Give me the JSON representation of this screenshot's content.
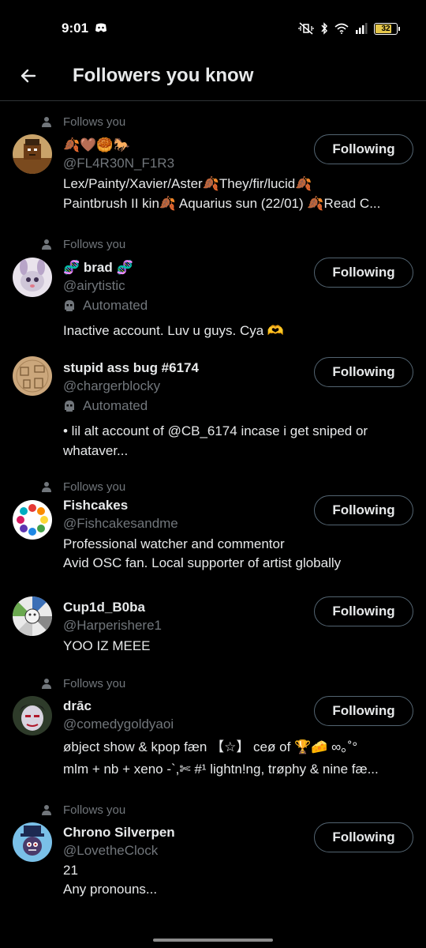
{
  "status_bar": {
    "time": "9:01",
    "battery": "32"
  },
  "header": {
    "title": "Followers you know"
  },
  "follow_button_label": "Following",
  "follows_you_label": "Follows you",
  "automated_label": "Automated",
  "users": [
    {
      "follows_you": true,
      "display_name": "🍂🤎🥮🐎",
      "handle": "@FL4R30N_F1R3",
      "automated": false,
      "bio": [
        "Lex/Painty/Xavier/Aster🍂They/fir/lucid🍂",
        "Paintbrush II kin🍂 Aquarius sun (22/01) 🍂Read C..."
      ]
    },
    {
      "follows_you": true,
      "display_name": "🧬 brad 🧬",
      "handle": "@airytistic",
      "automated": true,
      "bio": [
        "Inactive account. Luv u guys. Cya 🫶"
      ]
    },
    {
      "follows_you": false,
      "display_name": "stupid ass bug #6174",
      "handle": "@chargerblocky",
      "automated": true,
      "bio": [
        "• lil alt account of @CB_6174  incase i get sniped or",
        "whataver..."
      ]
    },
    {
      "follows_you": true,
      "display_name": "Fishcakes",
      "handle": "@Fishcakesandme",
      "automated": false,
      "bio": [
        "Professional watcher and commentor",
        "Avid OSC fan. Local supporter of artist globally"
      ]
    },
    {
      "follows_you": false,
      "display_name": "Cup1d_B0ba",
      "handle": "@Harperishere1",
      "automated": false,
      "bio": [
        "YOO IZ MEEE"
      ]
    },
    {
      "follows_you": true,
      "display_name": "drāc",
      "handle": "@comedygoldyaoi",
      "automated": false,
      "bio": [
        "øbject show & kpop fæn 【☆】 ceø of 🏆🧀 ∞｡˚°",
        "mlm + nb + xeno -`,✄ #¹ lightn!ng, trøphy & nine fæ..."
      ]
    },
    {
      "follows_you": true,
      "display_name": "Chrono Silverpen",
      "handle": "@LovetheClock",
      "automated": false,
      "bio": [
        "21",
        "Any pronouns..."
      ]
    }
  ],
  "colors": {
    "background": "#000000",
    "primary_text": "#e7e9ea",
    "secondary_text": "#71767b",
    "divider": "#2f3336",
    "button_border": "#536471"
  }
}
